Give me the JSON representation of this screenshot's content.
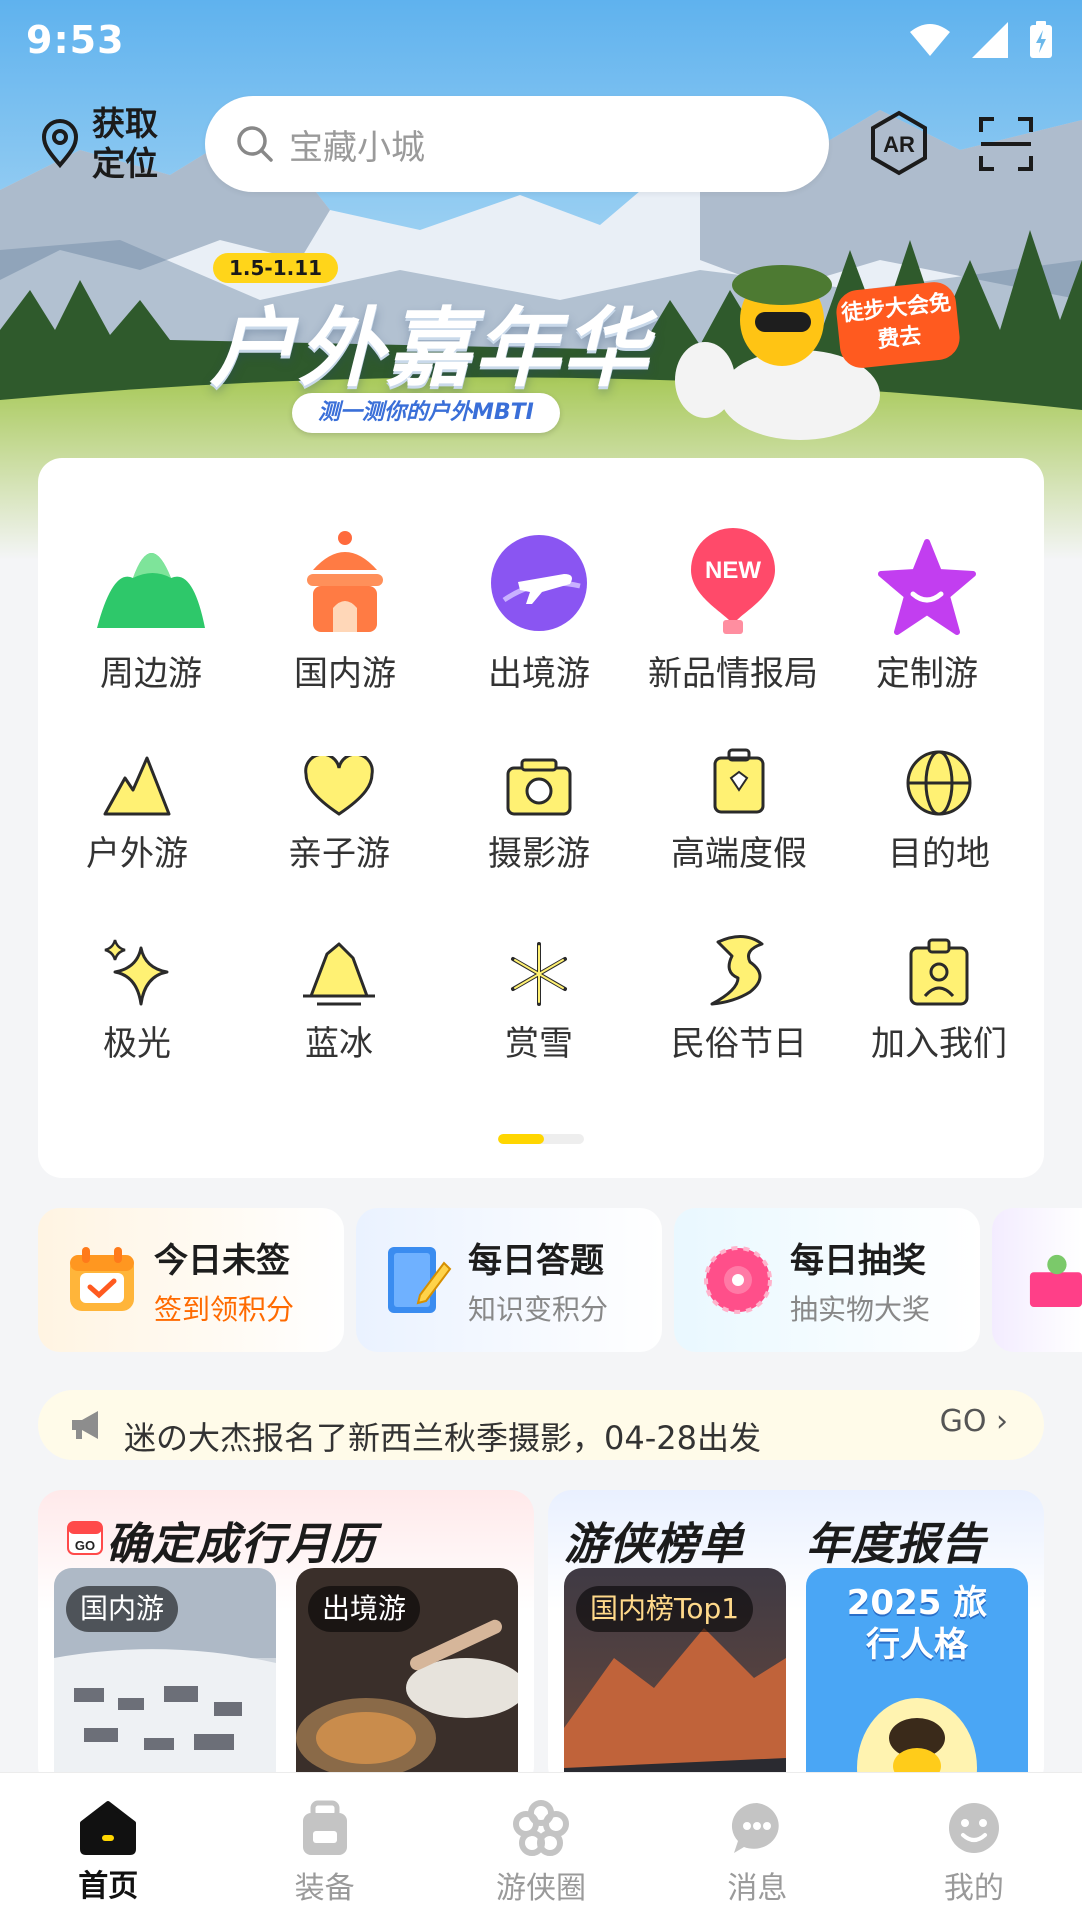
{
  "status_bar": {
    "time": "9:53"
  },
  "header": {
    "location_label": "获取定位",
    "search_placeholder": "宝藏小城"
  },
  "banner": {
    "date_badge": "1.5-1.11",
    "title": "户外嘉年华",
    "subtitle": "测一测你的户外MBTI",
    "tag": "徒步大会免费去"
  },
  "categories": {
    "row1": [
      {
        "label": "周边游",
        "icon": "mountain-green-icon"
      },
      {
        "label": "国内游",
        "icon": "temple-icon"
      },
      {
        "label": "出境游",
        "icon": "plane-icon"
      },
      {
        "label": "新品情报局",
        "icon": "new-balloon-icon"
      },
      {
        "label": "定制游",
        "icon": "star-smile-icon"
      }
    ],
    "row2": [
      {
        "label": "户外游",
        "icon": "mountain-yellow-icon"
      },
      {
        "label": "亲子游",
        "icon": "hearts-icon"
      },
      {
        "label": "摄影游",
        "icon": "camera-icon"
      },
      {
        "label": "高端度假",
        "icon": "luggage-icon"
      },
      {
        "label": "目的地",
        "icon": "globe-icon"
      }
    ],
    "row3": [
      {
        "label": "极光",
        "icon": "sparkle-icon"
      },
      {
        "label": "蓝冰",
        "icon": "iceberg-icon"
      },
      {
        "label": "赏雪",
        "icon": "snowflake-icon"
      },
      {
        "label": "民俗节日",
        "icon": "dragon-icon"
      },
      {
        "label": "加入我们",
        "icon": "badge-icon"
      }
    ],
    "page_indicator": {
      "current": 1,
      "total": 2
    }
  },
  "quick_actions": [
    {
      "title": "今日未签",
      "subtitle": "签到领积分",
      "icon": "calendar-check-icon"
    },
    {
      "title": "每日答题",
      "subtitle": "知识变积分",
      "icon": "notebook-pen-icon"
    },
    {
      "title": "每日抽奖",
      "subtitle": "抽实物大奖",
      "icon": "lottery-wheel-icon"
    }
  ],
  "notice": {
    "text": "迷の大杰报名了新西兰秋季摄影，04-28出发",
    "go_label": "GO"
  },
  "calendar_card": {
    "title": "确定成行月历",
    "calendar_icon_text": "GO",
    "items": [
      {
        "tag": "国内游"
      },
      {
        "tag": "出境游"
      }
    ]
  },
  "rank_card": {
    "title": "游侠榜单",
    "tag": "国内榜Top1"
  },
  "report_card": {
    "title": "年度报告",
    "art_text": "2025 旅行人格"
  },
  "tabbar": [
    {
      "label": "首页",
      "active": true,
      "icon": "home-icon"
    },
    {
      "label": "装备",
      "active": false,
      "icon": "backpack-icon"
    },
    {
      "label": "游侠圈",
      "active": false,
      "icon": "flower-icon"
    },
    {
      "label": "消息",
      "active": false,
      "icon": "chat-bubble-icon"
    },
    {
      "label": "我的",
      "active": false,
      "icon": "smiley-icon"
    }
  ],
  "colors": {
    "accent_yellow": "#ffd600",
    "sign_orange": "#ff6a00",
    "sky": "#6fb6e8"
  }
}
